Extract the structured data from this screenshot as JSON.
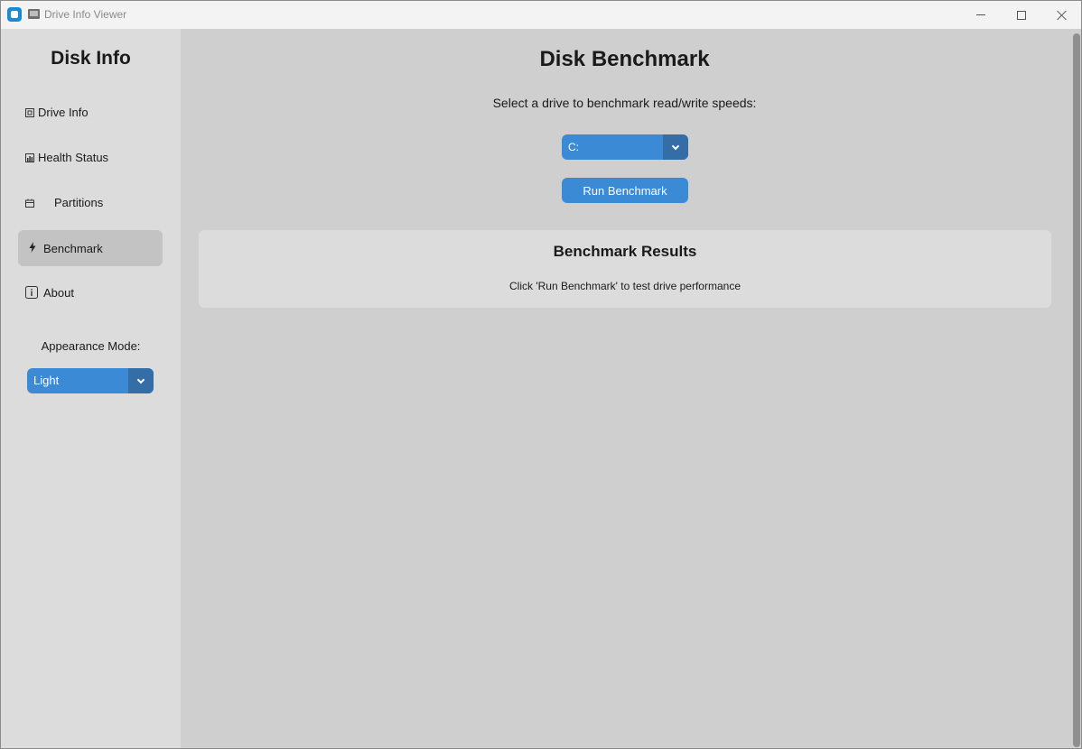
{
  "window": {
    "title": "Drive Info Viewer",
    "controls": {
      "minimize": "minimize-icon",
      "maximize": "maximize-icon",
      "close": "close-icon"
    }
  },
  "sidebar": {
    "title": "Disk Info",
    "items": [
      {
        "label": "Drive Info",
        "icon": "drive-icon",
        "active": false
      },
      {
        "label": "Health Status",
        "icon": "chart-icon",
        "active": false
      },
      {
        "label": "Partitions",
        "icon": "partition-icon",
        "active": false
      },
      {
        "label": "Benchmark",
        "icon": "lightning-icon",
        "active": true
      },
      {
        "label": "About",
        "icon": "info-icon",
        "active": false
      }
    ],
    "appearance_label": "Appearance Mode:",
    "appearance_value": "Light"
  },
  "main": {
    "title": "Disk Benchmark",
    "subtitle": "Select a drive to benchmark read/write speeds:",
    "drive_value": "C:",
    "run_button_label": "Run Benchmark",
    "results": {
      "title": "Benchmark Results",
      "text": "Click 'Run Benchmark' to test drive performance"
    }
  },
  "colors": {
    "accent": "#3a8ad6",
    "accent_dark": "#356ea6",
    "sidebar_bg": "#dcdcdc",
    "main_bg": "#cfcfcf",
    "active_item_bg": "#c3c3c3"
  }
}
